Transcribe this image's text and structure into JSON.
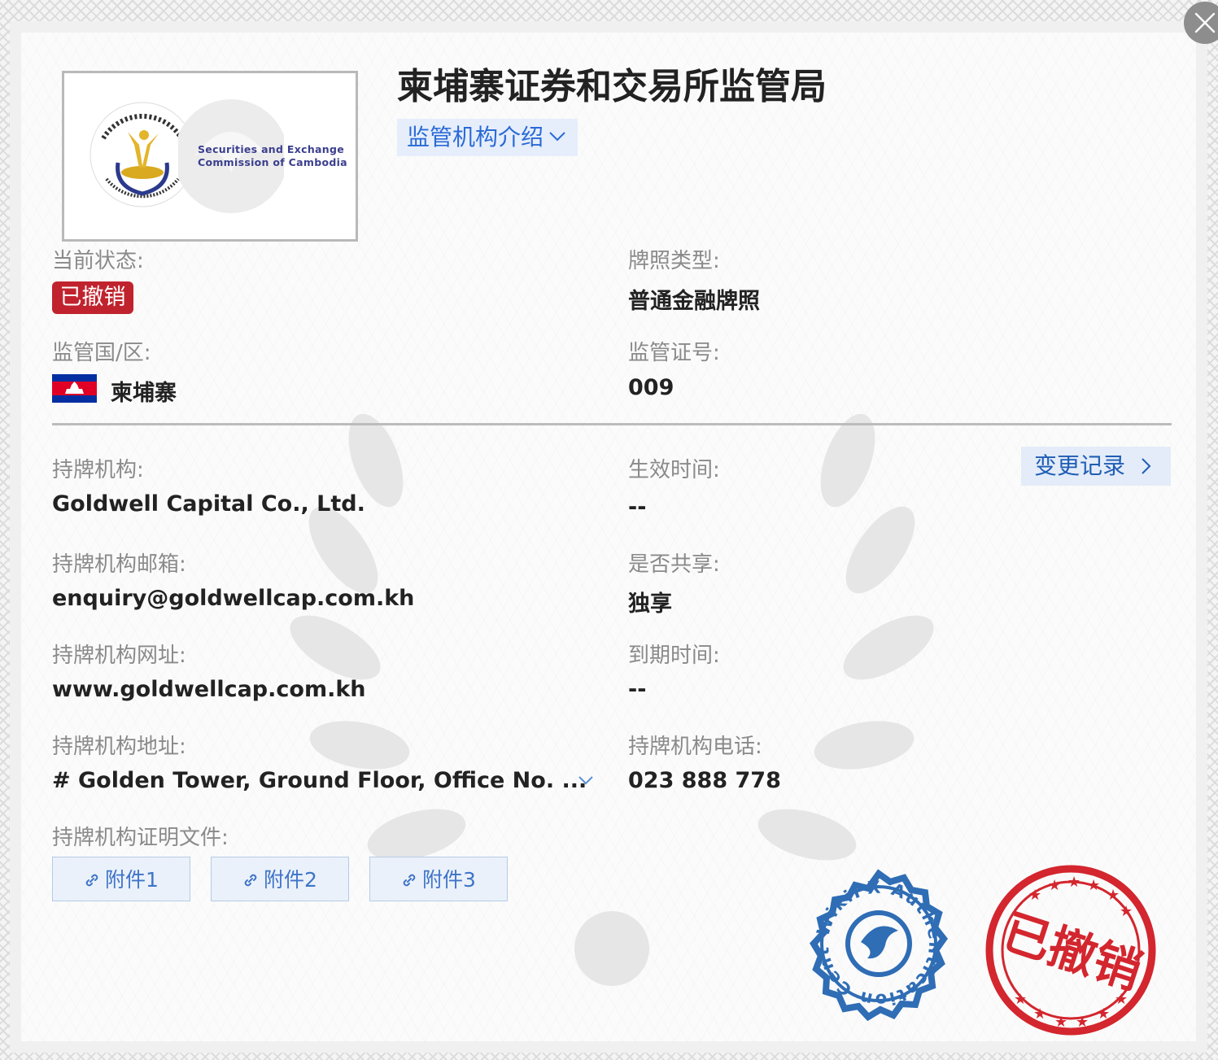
{
  "header": {
    "title": "柬埔寨证券和交易所监管局",
    "intro_button": "监管机构介绍"
  },
  "logo": {
    "line1": "Securities and Exchange",
    "line2": "Commission of Cambodia"
  },
  "info": {
    "status_label": "当前状态:",
    "status_value": "已撤销",
    "license_type_label": "牌照类型:",
    "license_type_value": "普通金融牌照",
    "region_label": "监管国/区:",
    "region_value": "柬埔寨",
    "license_no_label": "监管证号:",
    "license_no_value": "009"
  },
  "holder": {
    "institution_label": "持牌机构:",
    "institution_value": "Goldwell Capital Co., Ltd.",
    "effective_label": "生效时间:",
    "effective_value": "--",
    "history_button": "变更记录",
    "email_label": "持牌机构邮箱:",
    "email_value": "enquiry@goldwellcap.com.kh",
    "shared_label": "是否共享:",
    "shared_value": "独享",
    "website_label": "持牌机构网址:",
    "website_value": "www.goldwellcap.com.kh",
    "expiry_label": "到期时间:",
    "expiry_value": "--",
    "address_label": "持牌机构地址:",
    "address_value": "# Golden Tower, Ground Floor, Office No. ...",
    "phone_label": "持牌机构电话:",
    "phone_value": "023 888 778",
    "documents_label": "持牌机构证明文件:",
    "attachments": [
      "附件1",
      "附件2",
      "附件3"
    ]
  },
  "seals": {
    "wikifx_text": "WikiFX Authentication Center",
    "revoked_text": "已撤销"
  },
  "colors": {
    "status_red": "#c0232e",
    "link_blue": "#2a6ad6",
    "seal_blue": "#2f6db5",
    "seal_red": "#d3262e"
  }
}
